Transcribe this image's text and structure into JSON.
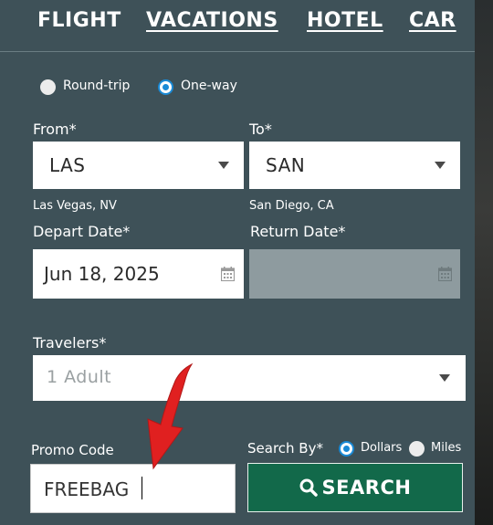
{
  "tabs": [
    {
      "label": "FLIGHT"
    },
    {
      "label": "VACATIONS"
    },
    {
      "label": "HOTEL"
    },
    {
      "label": "CAR"
    }
  ],
  "trip_type": {
    "options": [
      {
        "label": "Round-trip",
        "selected": false
      },
      {
        "label": "One-way",
        "selected": true
      }
    ]
  },
  "from": {
    "label": "From*",
    "value": "LAS",
    "city": "Las Vegas, NV"
  },
  "to": {
    "label": "To*",
    "value": "SAN",
    "city": "San Diego, CA"
  },
  "depart": {
    "label": "Depart Date*",
    "value": "Jun 18, 2025"
  },
  "return_date": {
    "label": "Return Date*",
    "value": "",
    "disabled": true
  },
  "travelers": {
    "label": "Travelers*",
    "value": "1 Adult"
  },
  "promo": {
    "label": "Promo Code",
    "value": "FREEBAG"
  },
  "search_by": {
    "label": "Search By*",
    "options": [
      {
        "label": "Dollars",
        "selected": true
      },
      {
        "label": "Miles",
        "selected": false
      }
    ]
  },
  "search_button": {
    "label": "SEARCH"
  },
  "icons": [
    "search-icon",
    "calendar-icon",
    "chevron-down-icon",
    "red-arrow-annotation"
  ],
  "colors": {
    "panel": "#3e5158",
    "search_button": "#12694a",
    "radio_accent": "#1a8ad6",
    "annotation_arrow": "#e02020"
  }
}
